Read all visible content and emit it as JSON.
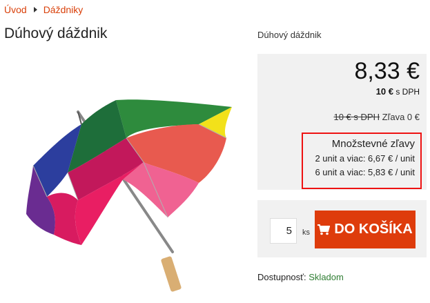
{
  "breadcrumb": {
    "home": "Úvod",
    "category": "Dáždniky"
  },
  "product": {
    "title": "Dúhový dáždnik",
    "side_name": "Dúhový dáždnik"
  },
  "price": {
    "main": "8,33 €",
    "vat_value": "10 €",
    "vat_suffix": "s DPH",
    "old_price": "10 € s DPH",
    "discount": "Zľava 0 €"
  },
  "quantity_discount": {
    "title": "Množstevné zľavy",
    "tiers": [
      "2 unit a viac: 6,67 € / unit",
      "6 unit a viac: 5,83 € / unit"
    ]
  },
  "cart": {
    "quantity": "5",
    "unit": "ks",
    "button_label": "DO KOŠÍKA"
  },
  "availability": {
    "label": "Dostupnosť:",
    "value": "Skladom"
  },
  "colors": {
    "accent": "#de3c0c",
    "highlight_border": "#ee1111",
    "stock": "#2e7d32",
    "panel": "#f1f1f1"
  },
  "icons": {
    "breadcrumb_separator": "triangle-right-icon",
    "cart": "shopping-cart-icon"
  }
}
